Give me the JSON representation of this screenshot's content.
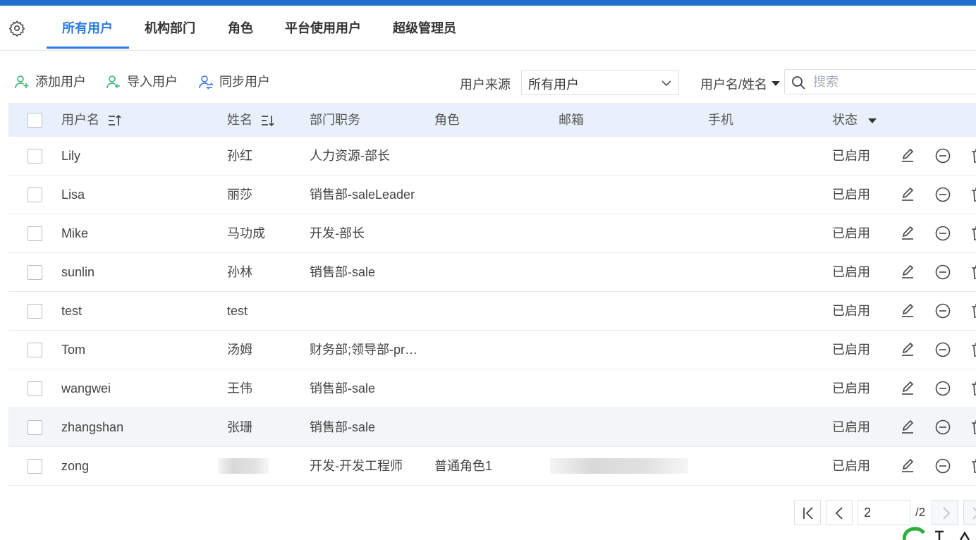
{
  "colors": {
    "accent": "#2b7be0",
    "topbar": "#1e6fcf",
    "header_bg": "#e8f1fb"
  },
  "tabs": [
    {
      "label": "所有用户",
      "active": true
    },
    {
      "label": "机构部门",
      "active": false
    },
    {
      "label": "角色",
      "active": false
    },
    {
      "label": "平台使用用户",
      "active": false
    },
    {
      "label": "超级管理员",
      "active": false
    }
  ],
  "toolbar": {
    "add_user": "添加用户",
    "import_user": "导入用户",
    "sync_user": "同步用户",
    "source_label": "用户来源",
    "source_value": "所有用户",
    "search_mode": "用户名/姓名",
    "search_placeholder": "搜索"
  },
  "table": {
    "columns": [
      "用户名",
      "姓名",
      "部门职务",
      "角色",
      "邮箱",
      "手机",
      "状态"
    ],
    "rows": [
      {
        "username": "Lily",
        "name": "孙红",
        "dept": "人力资源-部长",
        "role": "",
        "status": "已启用"
      },
      {
        "username": "Lisa",
        "name": "丽莎",
        "dept": "销售部-saleLeader",
        "role": "",
        "status": "已启用"
      },
      {
        "username": "Mike",
        "name": "马功成",
        "dept": "开发-部长",
        "role": "",
        "status": "已启用"
      },
      {
        "username": "sunlin",
        "name": "孙林",
        "dept": "销售部-sale",
        "role": "",
        "status": "已启用"
      },
      {
        "username": "test",
        "name": "test",
        "dept": "",
        "role": "",
        "status": "已启用"
      },
      {
        "username": "Tom",
        "name": "汤姆",
        "dept": "财务部;领导部-pr…",
        "role": "",
        "status": "已启用"
      },
      {
        "username": "wangwei",
        "name": "王伟",
        "dept": "销售部-sale",
        "role": "",
        "status": "已启用"
      },
      {
        "username": "zhangshan",
        "name": "张珊",
        "dept": "销售部-sale",
        "role": "",
        "status": "已启用"
      },
      {
        "username": "zong",
        "name": "",
        "dept": "开发-开发工程师",
        "role": "普通角色1",
        "status": "已启用"
      }
    ]
  },
  "pagination": {
    "current_page": "2",
    "total": "/2"
  },
  "icons": [
    "gear-icon",
    "add-user-icon",
    "import-user-icon",
    "sync-user-icon",
    "chevron-down-icon",
    "search-icon",
    "sort-icon",
    "edit-icon",
    "disable-icon",
    "delete-icon",
    "first-page-icon",
    "prev-page-icon",
    "next-page-icon",
    "last-page-icon"
  ]
}
